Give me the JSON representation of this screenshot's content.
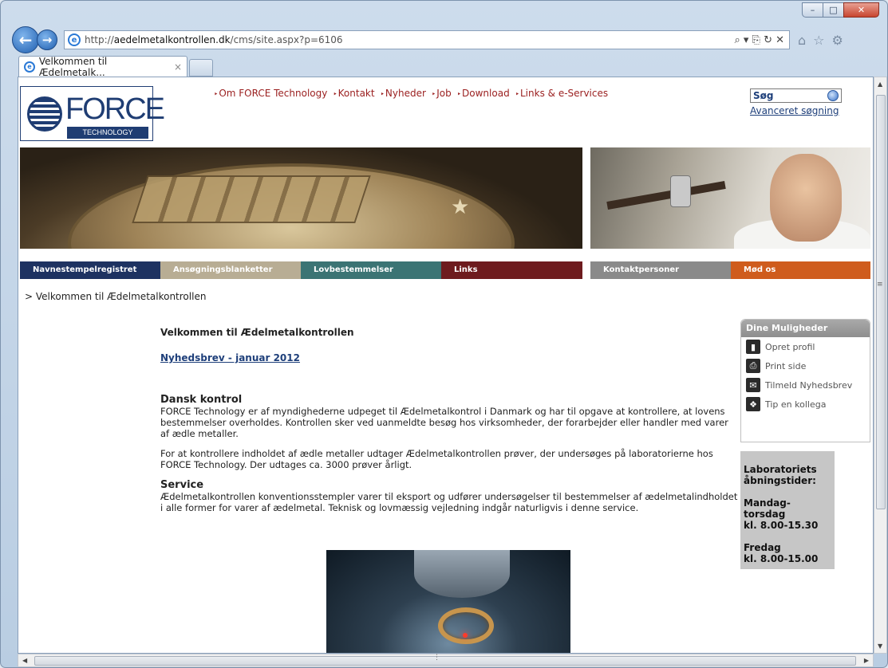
{
  "browser": {
    "url_prefix": "http://",
    "url_host": "aedelmetalkontrollen.dk",
    "url_path": "/cms/site.aspx?p=6106",
    "address_tools": "⌕ ▾  ⎘ ↻ ✕",
    "tab_title": "Velkommen til Ædelmetalk...",
    "tab_close": "×",
    "min_label": "–",
    "max_label": "□",
    "close_label": "✕"
  },
  "logo": {
    "name": "FORCE",
    "subtitle": "TECHNOLOGY"
  },
  "top_nav": [
    "Om FORCE Technology",
    "Kontakt",
    "Nyheder",
    "Job",
    "Download",
    "Links & e-Services"
  ],
  "search": {
    "label": "Søg",
    "advanced": "Avanceret søgning"
  },
  "main_tabs": [
    {
      "label": "Navnestempelregistret",
      "color": "#1e3261"
    },
    {
      "label": "Ansøgningsblanketter",
      "color": "#b8ad94"
    },
    {
      "label": "Lovbestemmelser",
      "color": "#3b7474"
    },
    {
      "label": "Links",
      "color": "#6e1b1e"
    }
  ],
  "side_tabs": [
    {
      "label": "Kontaktpersoner",
      "color": "#8a8a8a"
    },
    {
      "label": "Mød os",
      "color": "#cf5c1d"
    }
  ],
  "breadcrumb": "> Velkommen til Ædelmetalkontrollen",
  "content": {
    "title": "Velkommen til Ædelmetalkontrollen",
    "news_link": "Nyhedsbrev - januar 2012",
    "section1_heading": "Dansk kontrol",
    "section1_p1": "FORCE Technology er af myndighederne udpeget til Ædelmetalkontrol i Danmark og har til opgave at kontrollere, at lovens bestemmelser overholdes. Kontrollen sker ved uanmeldte besøg hos virksomheder, der forarbejder eller handler med varer af ædle metaller.",
    "section1_p2": "For at kontrollere indholdet af ædle metaller udtager Ædelmetalkontrollen prøver, der undersøges på laboratorierne hos FORCE Technology. Der udtages ca. 3000 prøver årligt.",
    "section2_heading": "Service",
    "section2_p1": "Ædelmetalkontrollen konventionsstempler varer til eksport og udfører undersøgelser til bestemmelser af ædelmetalindholdet i alle former for varer af ædelmetal. Teknisk og lovmæssig vejledning indgår naturligvis i denne service."
  },
  "sidebar": {
    "title": "Dine Muligheder",
    "items": [
      {
        "label": "Opret profil",
        "icon": "▮"
      },
      {
        "label": "Print side",
        "icon": "⎙"
      },
      {
        "label": "Tilmeld Nyhedsbrev",
        "icon": "✉"
      },
      {
        "label": "Tip en kollega",
        "icon": "❖"
      }
    ]
  },
  "hours": {
    "title": "Laboratoriets åbningstider:",
    "weekday_label": "Mandag-torsdag",
    "weekday_time": "kl. 8.00-15.30",
    "friday_label": "Fredag",
    "friday_time": "kl. 8.00-15.00"
  }
}
